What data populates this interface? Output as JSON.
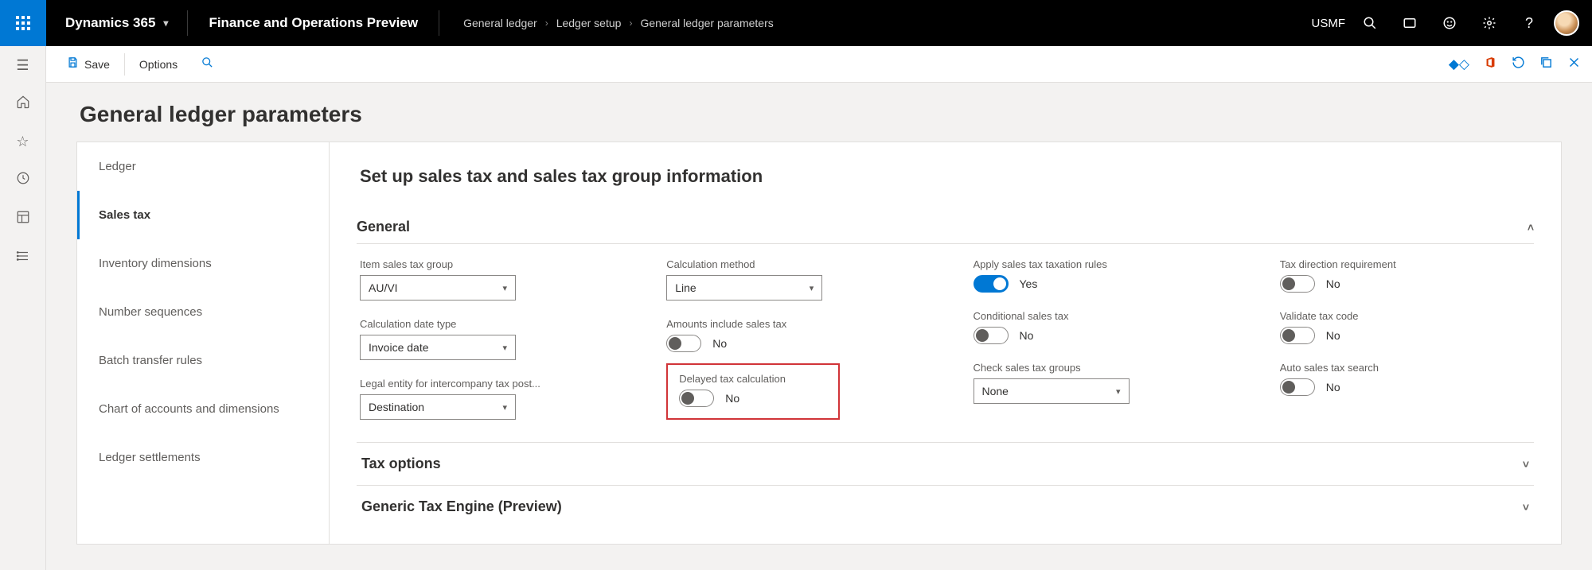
{
  "topbar": {
    "brand": "Dynamics 365",
    "module": "Finance and Operations Preview",
    "breadcrumbs": [
      "General ledger",
      "Ledger setup",
      "General ledger parameters"
    ],
    "company": "USMF"
  },
  "actionbar": {
    "save": "Save",
    "options": "Options"
  },
  "page": {
    "title": "General ledger parameters",
    "subtitle": "Set up sales tax and sales tax group information"
  },
  "sidetabs": [
    "Ledger",
    "Sales tax",
    "Inventory dimensions",
    "Number sequences",
    "Batch transfer rules",
    "Chart of accounts and dimensions",
    "Ledger settlements"
  ],
  "fasttabs": {
    "general": "General",
    "tax_options": "Tax options",
    "generic_engine": "Generic Tax Engine (Preview)"
  },
  "fields": {
    "item_sales_tax_group": {
      "label": "Item sales tax group",
      "value": "AU/VI"
    },
    "calculation_date_type": {
      "label": "Calculation date type",
      "value": "Invoice date"
    },
    "legal_entity_intercompany": {
      "label": "Legal entity for intercompany tax post...",
      "value": "Destination"
    },
    "calculation_method": {
      "label": "Calculation method",
      "value": "Line"
    },
    "amounts_include": {
      "label": "Amounts include sales tax",
      "value": "No"
    },
    "delayed_tax": {
      "label": "Delayed tax calculation",
      "value": "No"
    },
    "apply_rules": {
      "label": "Apply sales tax taxation rules",
      "value": "Yes"
    },
    "conditional": {
      "label": "Conditional sales tax",
      "value": "No"
    },
    "check_groups": {
      "label": "Check sales tax groups",
      "value": "None"
    },
    "tax_direction": {
      "label": "Tax direction requirement",
      "value": "No"
    },
    "validate_code": {
      "label": "Validate tax code",
      "value": "No"
    },
    "auto_search": {
      "label": "Auto sales tax search",
      "value": "No"
    }
  }
}
